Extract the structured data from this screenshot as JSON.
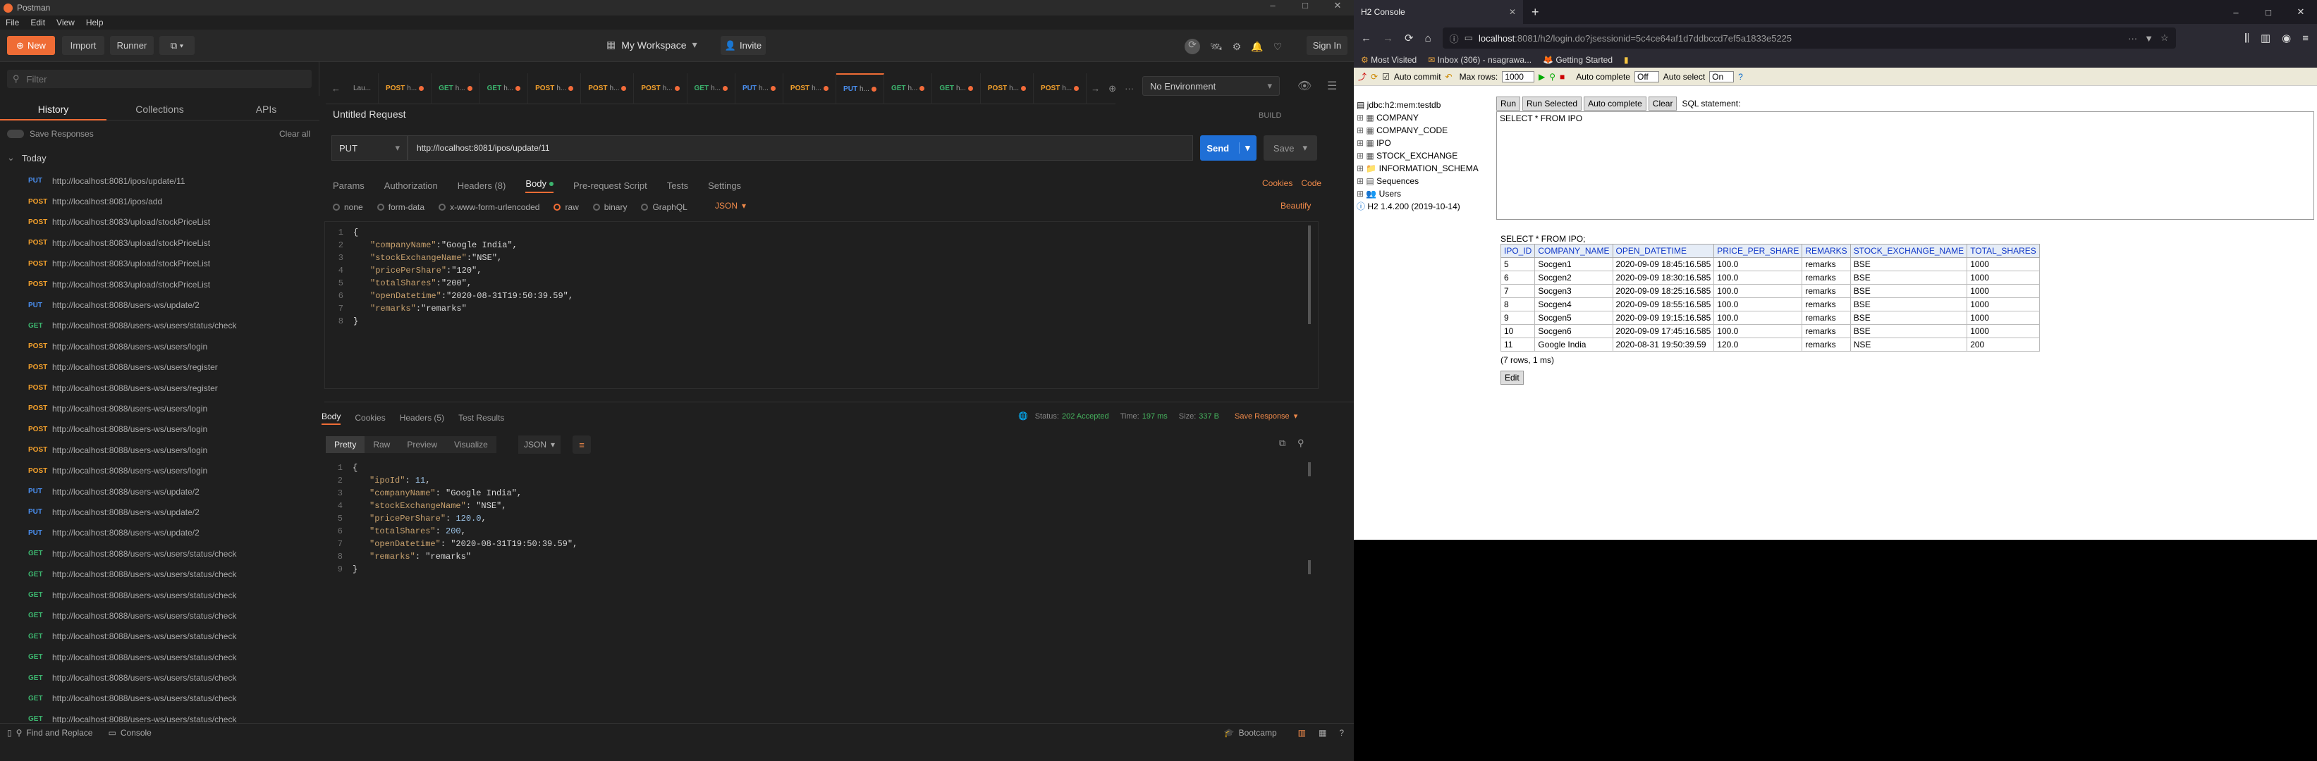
{
  "postman": {
    "title": "Postman",
    "menu": [
      "File",
      "Edit",
      "View",
      "Help"
    ],
    "new_btn": "New",
    "import_btn": "Import",
    "runner_btn": "Runner",
    "workspace": "My Workspace",
    "invite": "Invite",
    "sign_in": "Sign In",
    "filter_placeholder": "Filter",
    "sidebar_tabs": [
      "History",
      "Collections",
      "APIs"
    ],
    "save_responses": "Save Responses",
    "clear_all": "Clear all",
    "today": "Today",
    "history": [
      {
        "m": "PUT",
        "u": "http://localhost:8081/ipos/update/11"
      },
      {
        "m": "POST",
        "u": "http://localhost:8081/ipos/add"
      },
      {
        "m": "POST",
        "u": "http://localhost:8083/upload/stockPriceList"
      },
      {
        "m": "POST",
        "u": "http://localhost:8083/upload/stockPriceList"
      },
      {
        "m": "POST",
        "u": "http://localhost:8083/upload/stockPriceList"
      },
      {
        "m": "POST",
        "u": "http://localhost:8083/upload/stockPriceList"
      },
      {
        "m": "PUT",
        "u": "http://localhost:8088/users-ws/update/2"
      },
      {
        "m": "GET",
        "u": "http://localhost:8088/users-ws/users/status/check"
      },
      {
        "m": "POST",
        "u": "http://localhost:8088/users-ws/users/login"
      },
      {
        "m": "POST",
        "u": "http://localhost:8088/users-ws/users/register"
      },
      {
        "m": "POST",
        "u": "http://localhost:8088/users-ws/users/register"
      },
      {
        "m": "POST",
        "u": "http://localhost:8088/users-ws/users/login"
      },
      {
        "m": "POST",
        "u": "http://localhost:8088/users-ws/users/login"
      },
      {
        "m": "POST",
        "u": "http://localhost:8088/users-ws/users/login"
      },
      {
        "m": "POST",
        "u": "http://localhost:8088/users-ws/users/login"
      },
      {
        "m": "PUT",
        "u": "http://localhost:8088/users-ws/update/2"
      },
      {
        "m": "PUT",
        "u": "http://localhost:8088/users-ws/update/2"
      },
      {
        "m": "PUT",
        "u": "http://localhost:8088/users-ws/update/2"
      },
      {
        "m": "GET",
        "u": "http://localhost:8088/users-ws/users/status/check"
      },
      {
        "m": "GET",
        "u": "http://localhost:8088/users-ws/users/status/check"
      },
      {
        "m": "GET",
        "u": "http://localhost:8088/users-ws/users/status/check"
      },
      {
        "m": "GET",
        "u": "http://localhost:8088/users-ws/users/status/check"
      },
      {
        "m": "GET",
        "u": "http://localhost:8088/users-ws/users/status/check"
      },
      {
        "m": "GET",
        "u": "http://localhost:8088/users-ws/users/status/check"
      },
      {
        "m": "GET",
        "u": "http://localhost:8088/users-ws/users/status/check"
      },
      {
        "m": "GET",
        "u": "http://localhost:8088/users-ws/users/status/check"
      },
      {
        "m": "GET",
        "u": "http://localhost:8088/users-ws/users/status/check"
      }
    ],
    "tabs": [
      {
        "m": "",
        "t": "Lau..."
      },
      {
        "m": "POST",
        "t": "h..."
      },
      {
        "m": "GET",
        "t": "h..."
      },
      {
        "m": "GET",
        "t": "h..."
      },
      {
        "m": "POST",
        "t": "h..."
      },
      {
        "m": "POST",
        "t": "h..."
      },
      {
        "m": "POST",
        "t": "h..."
      },
      {
        "m": "GET",
        "t": "h..."
      },
      {
        "m": "PUT",
        "t": "h..."
      },
      {
        "m": "POST",
        "t": "h..."
      },
      {
        "m": "PUT",
        "t": "h..."
      },
      {
        "m": "GET",
        "t": "h..."
      },
      {
        "m": "GET",
        "t": "h..."
      },
      {
        "m": "POST",
        "t": "h..."
      },
      {
        "m": "POST",
        "t": "h..."
      }
    ],
    "environment": "No Environment",
    "request_title": "Untitled Request",
    "build": "BUILD",
    "method": "PUT",
    "url": "http://localhost:8081/ipos/update/11",
    "send": "Send",
    "save": "Save",
    "req_tabs": [
      "Params",
      "Authorization",
      "Headers (8)",
      "Body",
      "Pre-request Script",
      "Tests",
      "Settings"
    ],
    "cookies": "Cookies",
    "code_link": "Code",
    "body_types": [
      "none",
      "form-data",
      "x-www-form-urlencoded",
      "raw",
      "binary",
      "GraphQL"
    ],
    "json_sel": "JSON",
    "beautify": "Beautify",
    "req_body": [
      [
        {
          "c": "p",
          "v": "{"
        }
      ],
      [
        {
          "c": "k",
          "v": "\"companyName\""
        },
        {
          "c": "p",
          "v": ":"
        },
        {
          "c": "s",
          "v": "\"Google India\""
        },
        {
          "c": "p",
          "v": ","
        }
      ],
      [
        {
          "c": "k",
          "v": "\"stockExchangeName\""
        },
        {
          "c": "p",
          "v": ":"
        },
        {
          "c": "s",
          "v": "\"NSE\""
        },
        {
          "c": "p",
          "v": ","
        }
      ],
      [
        {
          "c": "k",
          "v": "\"pricePerShare\""
        },
        {
          "c": "p",
          "v": ":"
        },
        {
          "c": "s",
          "v": "\"120\""
        },
        {
          "c": "p",
          "v": ","
        }
      ],
      [
        {
          "c": "k",
          "v": "\"totalShares\""
        },
        {
          "c": "p",
          "v": ":"
        },
        {
          "c": "s",
          "v": "\"200\""
        },
        {
          "c": "p",
          "v": ","
        }
      ],
      [
        {
          "c": "k",
          "v": "\"openDatetime\""
        },
        {
          "c": "p",
          "v": ":"
        },
        {
          "c": "s",
          "v": "\"2020-08-31T19:50:39.59\""
        },
        {
          "c": "p",
          "v": ","
        }
      ],
      [
        {
          "c": "k",
          "v": "\"remarks\""
        },
        {
          "c": "p",
          "v": ":"
        },
        {
          "c": "s",
          "v": "\"remarks\""
        }
      ],
      [
        {
          "c": "p",
          "v": "}"
        }
      ]
    ],
    "resp_tabs": [
      "Body",
      "Cookies",
      "Headers (5)",
      "Test Results"
    ],
    "status_label": "Status:",
    "status": "202 Accepted",
    "time_label": "Time:",
    "time": "197 ms",
    "size_label": "Size:",
    "size": "337 B",
    "save_response": "Save Response",
    "view_modes": [
      "Pretty",
      "Raw",
      "Preview",
      "Visualize"
    ],
    "resp_body": [
      [
        {
          "c": "p",
          "v": "{"
        }
      ],
      [
        {
          "c": "k",
          "v": "\"ipoId\""
        },
        {
          "c": "p",
          "v": ": "
        },
        {
          "c": "n",
          "v": "11"
        },
        {
          "c": "p",
          "v": ","
        }
      ],
      [
        {
          "c": "k",
          "v": "\"companyName\""
        },
        {
          "c": "p",
          "v": ": "
        },
        {
          "c": "s",
          "v": "\"Google India\""
        },
        {
          "c": "p",
          "v": ","
        }
      ],
      [
        {
          "c": "k",
          "v": "\"stockExchangeName\""
        },
        {
          "c": "p",
          "v": ": "
        },
        {
          "c": "s",
          "v": "\"NSE\""
        },
        {
          "c": "p",
          "v": ","
        }
      ],
      [
        {
          "c": "k",
          "v": "\"pricePerShare\""
        },
        {
          "c": "p",
          "v": ": "
        },
        {
          "c": "n",
          "v": "120.0"
        },
        {
          "c": "p",
          "v": ","
        }
      ],
      [
        {
          "c": "k",
          "v": "\"totalShares\""
        },
        {
          "c": "p",
          "v": ": "
        },
        {
          "c": "n",
          "v": "200"
        },
        {
          "c": "p",
          "v": ","
        }
      ],
      [
        {
          "c": "k",
          "v": "\"openDatetime\""
        },
        {
          "c": "p",
          "v": ": "
        },
        {
          "c": "s",
          "v": "\"2020-08-31T19:50:39.59\""
        },
        {
          "c": "p",
          "v": ","
        }
      ],
      [
        {
          "c": "k",
          "v": "\"remarks\""
        },
        {
          "c": "p",
          "v": ": "
        },
        {
          "c": "s",
          "v": "\"remarks\""
        }
      ],
      [
        {
          "c": "p",
          "v": "}"
        }
      ]
    ],
    "find_replace": "Find and Replace",
    "console": "Console",
    "bootcamp": "Bootcamp"
  },
  "firefox": {
    "tab_title": "H2 Console",
    "url_host": "localhost",
    "url_rest": ":8081/h2/login.do?jsessionid=5c4ce64af1d7ddbccd7ef5a1833e5225",
    "bookmarks": [
      "Most Visited",
      "Inbox (306) - nsagrawa...",
      "Getting Started"
    ]
  },
  "h2": {
    "auto_commit": "Auto commit",
    "max_rows_label": "Max rows:",
    "max_rows": "1000",
    "auto_complete_label": "Auto complete",
    "auto_complete": "Off",
    "auto_select_label": "Auto select",
    "auto_select": "On",
    "buttons": [
      "Run",
      "Run Selected",
      "Auto complete",
      "Clear"
    ],
    "sql_label": "SQL statement:",
    "sql": "SELECT * FROM IPO",
    "tree_root": "jdbc:h2:mem:testdb",
    "tree": [
      "COMPANY",
      "COMPANY_CODE",
      "IPO",
      "STOCK_EXCHANGE",
      "INFORMATION_SCHEMA",
      "Sequences",
      "Users"
    ],
    "version": "H2 1.4.200 (2019-10-14)",
    "result_query": "SELECT * FROM IPO;",
    "columns": [
      "IPO_ID",
      "COMPANY_NAME",
      "OPEN_DATETIME",
      "PRICE_PER_SHARE",
      "REMARKS",
      "STOCK_EXCHANGE_NAME",
      "TOTAL_SHARES"
    ],
    "rows": [
      [
        "5",
        "Socgen1",
        "2020-09-09 18:45:16.585",
        "100.0",
        "remarks",
        "BSE",
        "1000"
      ],
      [
        "6",
        "Socgen2",
        "2020-09-09 18:30:16.585",
        "100.0",
        "remarks",
        "BSE",
        "1000"
      ],
      [
        "7",
        "Socgen3",
        "2020-09-09 18:25:16.585",
        "100.0",
        "remarks",
        "BSE",
        "1000"
      ],
      [
        "8",
        "Socgen4",
        "2020-09-09 18:55:16.585",
        "100.0",
        "remarks",
        "BSE",
        "1000"
      ],
      [
        "9",
        "Socgen5",
        "2020-09-09 19:15:16.585",
        "100.0",
        "remarks",
        "BSE",
        "1000"
      ],
      [
        "10",
        "Socgen6",
        "2020-09-09 17:45:16.585",
        "100.0",
        "remarks",
        "BSE",
        "1000"
      ],
      [
        "11",
        "Google India",
        "2020-08-31 19:50:39.59",
        "120.0",
        "remarks",
        "NSE",
        "200"
      ]
    ],
    "row_count": "(7 rows, 1 ms)",
    "edit": "Edit"
  }
}
